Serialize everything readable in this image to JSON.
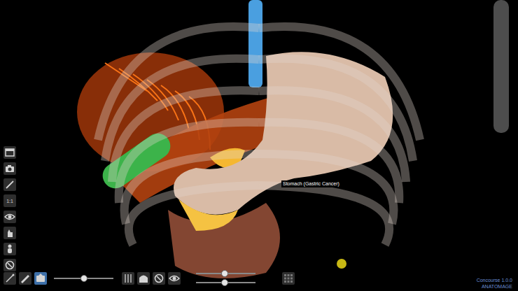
{
  "viewport": {
    "labels": [
      {
        "text": "Stomach (Gastric Cancer)"
      }
    ]
  },
  "left_toolbar": [
    {
      "kind": "icon"
    },
    {
      "kind": "icon"
    },
    {
      "kind": "icon"
    },
    {
      "kind": "text",
      "label": "1:1"
    },
    {
      "kind": "icon"
    },
    {
      "kind": "icon"
    },
    {
      "kind": "icon"
    },
    {
      "kind": "icon"
    }
  ],
  "bottom_toolbar": [
    {
      "kind": "icon",
      "selected": false
    },
    {
      "kind": "icon",
      "selected": false
    },
    {
      "kind": "icon",
      "selected": true
    },
    {
      "kind": "slider",
      "level": 0.5
    },
    {
      "kind": "icon",
      "selected": false
    },
    {
      "kind": "icon",
      "selected": false
    },
    {
      "kind": "icon",
      "selected": false
    },
    {
      "kind": "icon",
      "selected": false
    },
    {
      "kind": "slider_pair",
      "levels": [
        0.48,
        0.48
      ]
    },
    {
      "kind": "icon",
      "selected": false
    }
  ],
  "version": {
    "product": "Concourse 1.0.0",
    "brand": "ANATOMAGE"
  }
}
